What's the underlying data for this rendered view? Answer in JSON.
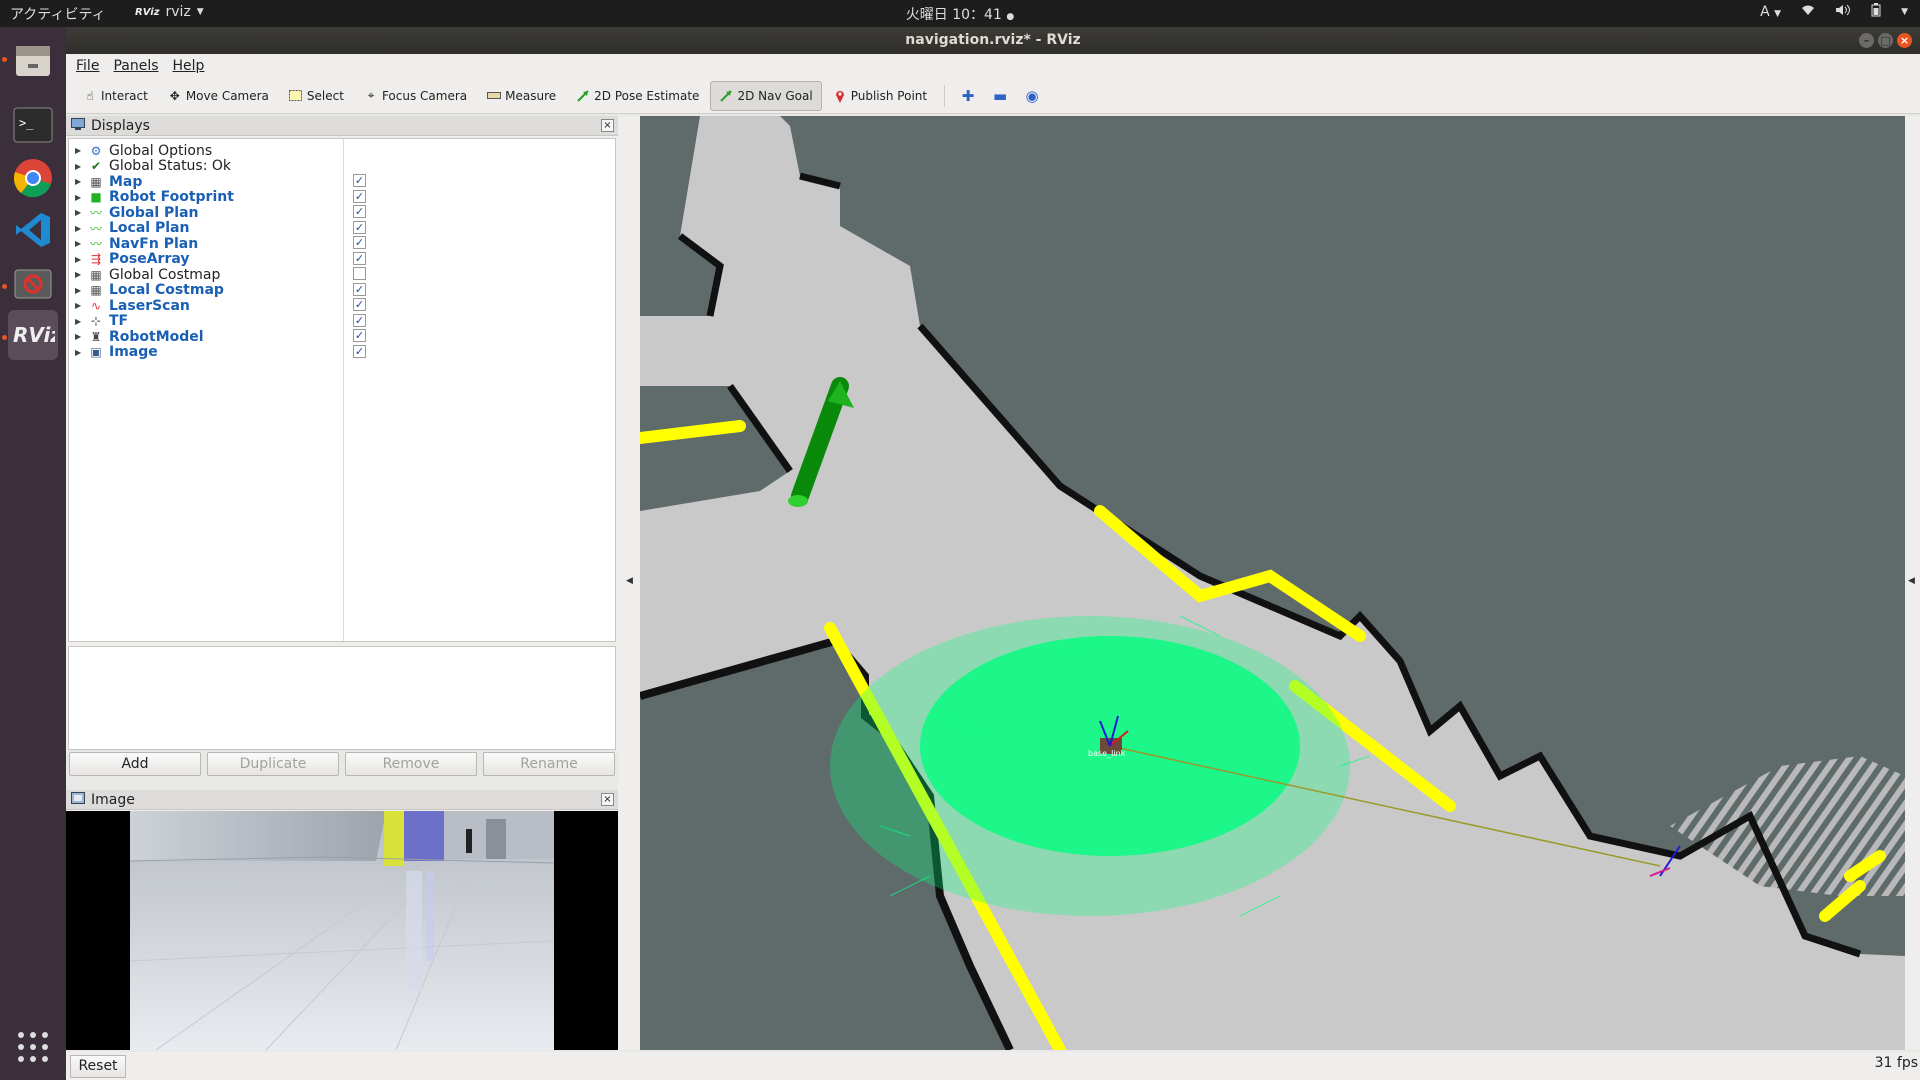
{
  "topbar": {
    "activities": "アクティビティ",
    "app_name": "rviz",
    "app_icon_text": "RViz",
    "clock": "火曜日 10：41",
    "input_method": "A"
  },
  "window": {
    "title": "navigation.rviz* - RViz"
  },
  "menu": {
    "file": "File",
    "panels": "Panels",
    "help": "Help"
  },
  "toolbar": {
    "interact": "Interact",
    "move_camera": "Move Camera",
    "select": "Select",
    "focus_camera": "Focus Camera",
    "measure": "Measure",
    "pose_estimate": "2D Pose Estimate",
    "nav_goal": "2D Nav Goal",
    "publish_point": "Publish Point",
    "active_tool": "2D Nav Goal"
  },
  "displays": {
    "title": "Displays",
    "items": [
      {
        "label": "Global Options",
        "icon": "gear-icon",
        "enabled": null,
        "highlight": false
      },
      {
        "label": "Global Status: Ok",
        "icon": "check-icon",
        "enabled": null,
        "highlight": false
      },
      {
        "label": "Map",
        "icon": "map-icon",
        "enabled": true,
        "highlight": true
      },
      {
        "label": "Robot Footprint",
        "icon": "polygon-icon",
        "enabled": true,
        "highlight": true
      },
      {
        "label": "Global Plan",
        "icon": "path-icon",
        "enabled": true,
        "highlight": true
      },
      {
        "label": "Local Plan",
        "icon": "path-icon",
        "enabled": true,
        "highlight": true
      },
      {
        "label": "NavFn Plan",
        "icon": "path-icon",
        "enabled": true,
        "highlight": true
      },
      {
        "label": "PoseArray",
        "icon": "pose-array-icon",
        "enabled": true,
        "highlight": true
      },
      {
        "label": "Global Costmap",
        "icon": "map-icon",
        "enabled": false,
        "highlight": false
      },
      {
        "label": "Local Costmap",
        "icon": "map-icon",
        "enabled": true,
        "highlight": true
      },
      {
        "label": "LaserScan",
        "icon": "laser-scan-icon",
        "enabled": true,
        "highlight": true
      },
      {
        "label": "TF",
        "icon": "axes-icon",
        "enabled": true,
        "highlight": true
      },
      {
        "label": "RobotModel",
        "icon": "robot-icon",
        "enabled": true,
        "highlight": true
      },
      {
        "label": "Image",
        "icon": "image-icon",
        "enabled": true,
        "highlight": true
      }
    ],
    "buttons": {
      "add": "Add",
      "duplicate": "Duplicate",
      "remove": "Remove",
      "rename": "Rename"
    }
  },
  "image_panel": {
    "title": "Image"
  },
  "view3d": {
    "robot_label": "base_link"
  },
  "status": {
    "reset": "Reset",
    "fps": "31 fps"
  },
  "colors": {
    "accent": "#e95420",
    "highlight_text": "#1a5fb4",
    "pose_array": "#00ff7f",
    "obstacle": "#ffff00",
    "goal_arrow": "#00a000",
    "free_space": "#c9c9c9",
    "unknown": "#5f6b6b"
  }
}
